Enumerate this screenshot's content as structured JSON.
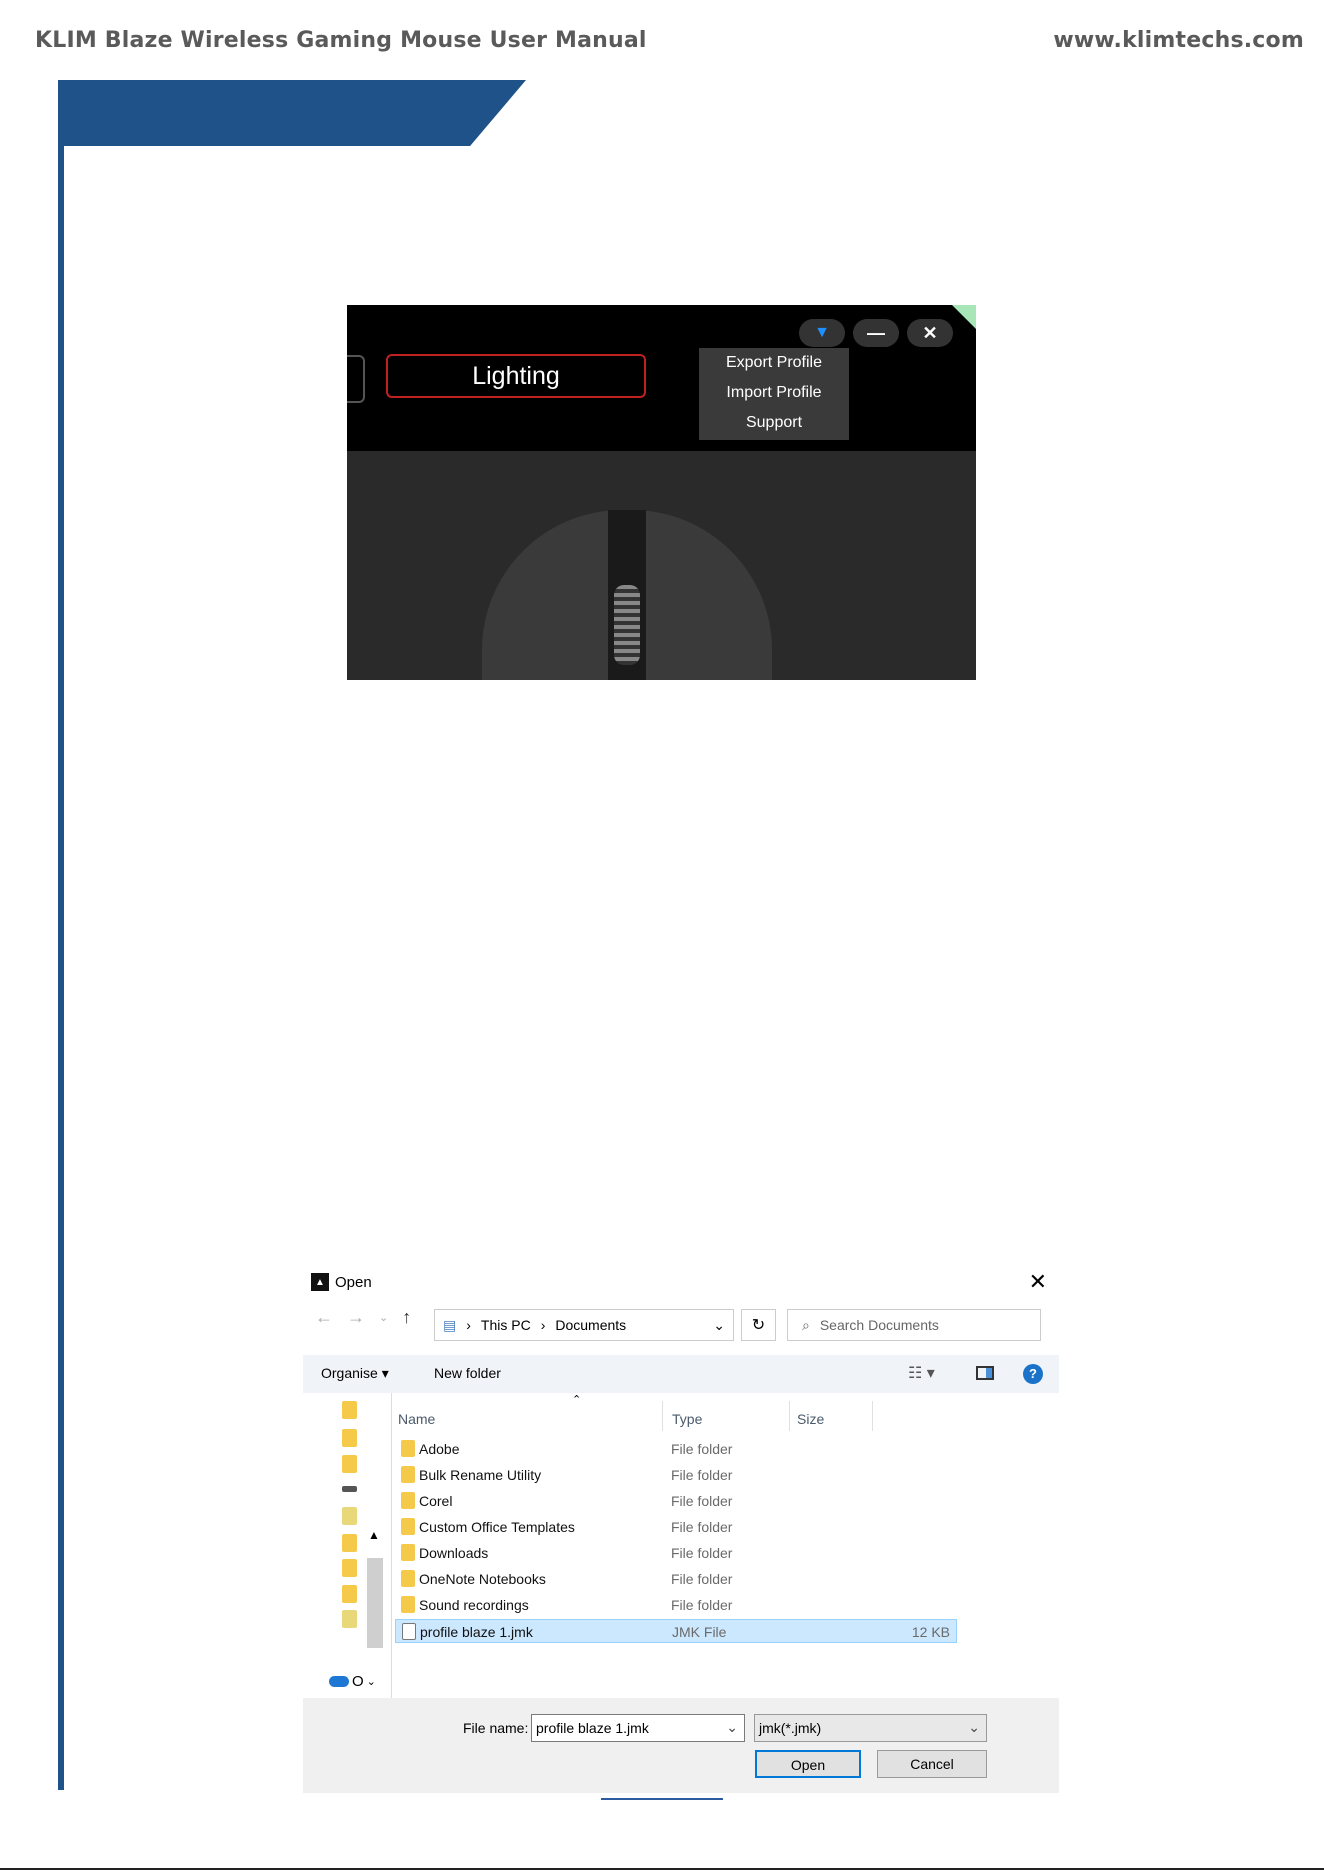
{
  "header": {
    "title": "KLIM Blaze Wireless Gaming Mouse User Manual",
    "url": "www.klimtechs.com"
  },
  "app": {
    "tab_label": "Lighting",
    "dropdown_icon": "triangle-down-icon",
    "minimize_icon": "minimize-icon",
    "close_icon": "close-icon",
    "menu": [
      "Export Profile",
      "Import Profile",
      "Support"
    ],
    "accent": "#1e90ff",
    "tab_border_color": "#c02020"
  },
  "dialog": {
    "title": "Open",
    "close_symbol": "✕",
    "breadcrumb": [
      "This PC",
      "Documents"
    ],
    "search_placeholder": "Search Documents",
    "toolbar": {
      "organise": "Organise ▾",
      "new_folder": "New folder"
    },
    "columns": {
      "name": "Name",
      "type": "Type",
      "size": "Size"
    },
    "rows": [
      {
        "name": "Adobe",
        "type": "File folder",
        "size": ""
      },
      {
        "name": "Bulk Rename Utility",
        "type": "File folder",
        "size": ""
      },
      {
        "name": "Corel",
        "type": "File folder",
        "size": ""
      },
      {
        "name": "Custom Office Templates",
        "type": "File folder",
        "size": ""
      },
      {
        "name": "Downloads",
        "type": "File folder",
        "size": ""
      },
      {
        "name": "OneNote Notebooks",
        "type": "File folder",
        "size": ""
      },
      {
        "name": "Sound recordings",
        "type": "File folder",
        "size": ""
      },
      {
        "name": "profile blaze 1.jmk",
        "type": "JMK File",
        "size": "12 KB",
        "selected": true
      }
    ],
    "onedrive_label": "O",
    "file_name_label": "File name:",
    "file_name_value": "profile blaze 1.jmk",
    "file_type_value": "jmk(*.jmk)",
    "open_label": "Open",
    "cancel_label": "Cancel"
  }
}
